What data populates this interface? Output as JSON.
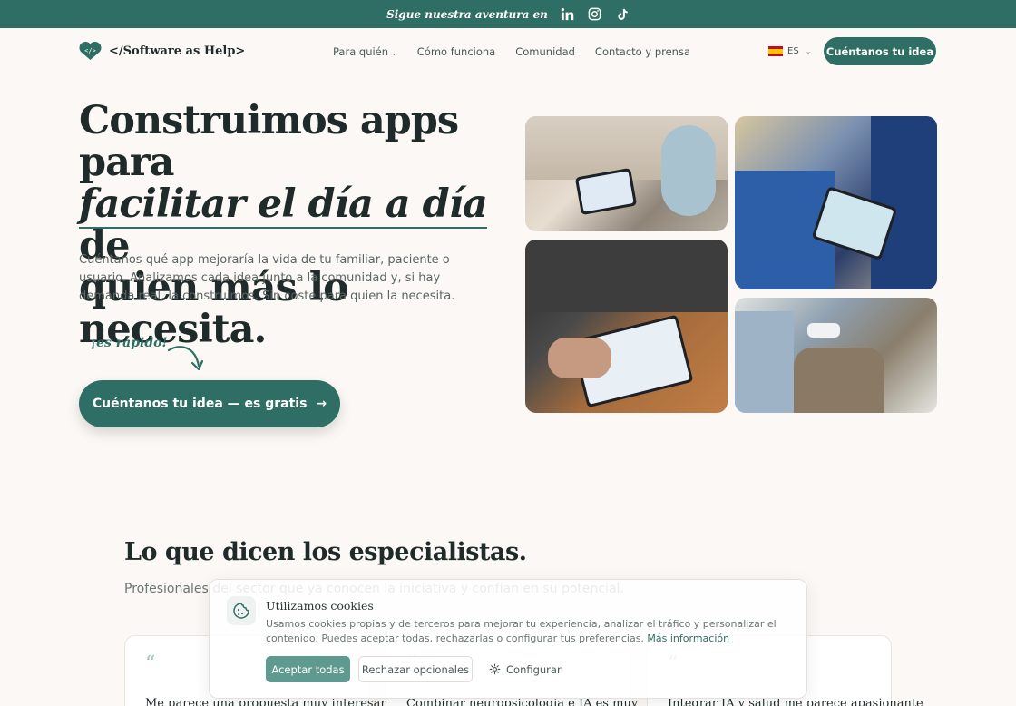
{
  "topbar": {
    "text": "Sigue nuestra aventura en",
    "icons": [
      "linkedin-icon",
      "instagram-icon",
      "tiktok-icon"
    ]
  },
  "brand": {
    "name": "</Software as Help>",
    "mark_text": "</>"
  },
  "nav": {
    "items": [
      {
        "label": "Para quién",
        "dropdown": true
      },
      {
        "label": "Cómo funciona"
      },
      {
        "label": "Comunidad"
      },
      {
        "label": "Contacto y prensa"
      }
    ],
    "language": "ES",
    "cta": "Cuéntanos tu idea"
  },
  "hero": {
    "title_line1": "Construimos apps para",
    "title_em": "facilitar el día a día",
    "title_mid": " de",
    "title_line3": "quien más lo necesita.",
    "subtitle": "Cuéntanos qué app mejoraría la vida de tu familiar, paciente o usuario. Analizamos cada idea junto a la comunidad y, si hay demanda real, la construimos. Sin coste para quien la necesita.",
    "quick_note": "¡es rápido!",
    "cta": "Cuéntanos tu idea — es gratis"
  },
  "testimonials": {
    "title": "Lo que dicen los especialistas.",
    "subtitle": "Profesionales del sector que ya conocen la iniciativa y confían en su potencial.",
    "cards": [
      {
        "quote_mark": "“",
        "text": "Me parece una propuesta muy interesante"
      },
      {
        "quote_mark": "“",
        "text": "Combinar neuropsicología e IA es muy"
      },
      {
        "quote_mark": "“",
        "text": "Integrar IA y salud me parece apasionante"
      }
    ]
  },
  "cookies": {
    "title": "Utilizamos cookies",
    "body": "Usamos cookies propias y de terceros para mejorar tu experiencia, analizar el tráfico y personalizar el contenido. Puedes aceptar todas, rechazarlas o configurar tus preferencias.",
    "link": "Más información",
    "accept": "Aceptar todas",
    "reject": "Rechazar opcionales",
    "configure": "Configurar"
  },
  "colors": {
    "primary": "#2f6e64",
    "background": "#fbf8f5",
    "text": "#1f2b2a"
  }
}
